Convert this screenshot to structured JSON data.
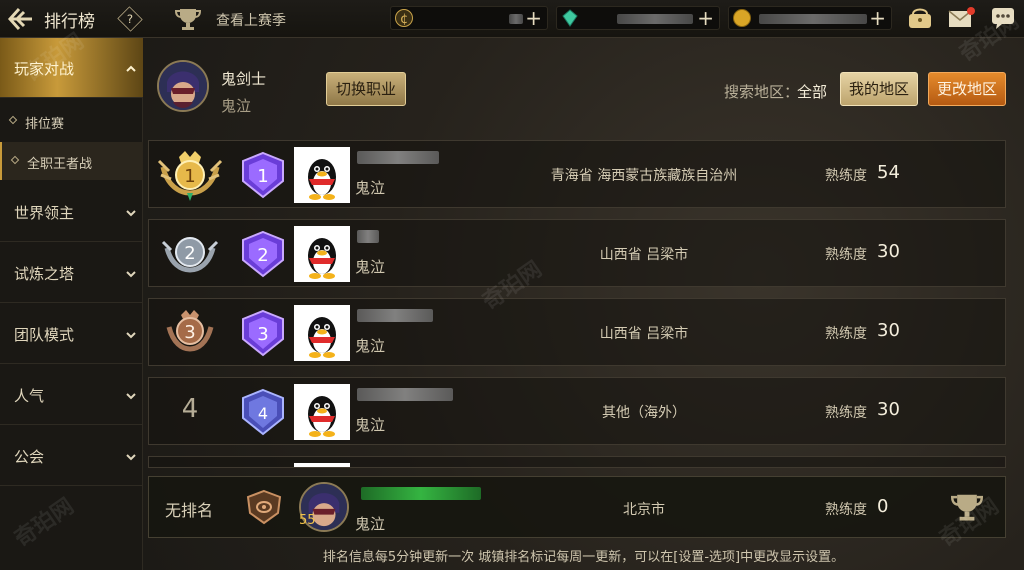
{
  "topbar": {
    "title": "排行榜",
    "help": "?",
    "last_season": "查看上赛季",
    "currencies": [
      {
        "icon": "coin-c-icon",
        "color": "#c9a34a"
      },
      {
        "icon": "gem-icon",
        "color": "#3fc9a0"
      },
      {
        "icon": "gold-coin-icon",
        "color": "#d9a526"
      }
    ],
    "plus": "+"
  },
  "sidebar": {
    "sections": [
      {
        "label": "玩家对战",
        "expanded": true
      },
      {
        "label": "世界领主"
      },
      {
        "label": "试炼之塔"
      },
      {
        "label": "团队模式"
      },
      {
        "label": "人气"
      },
      {
        "label": "公会"
      }
    ],
    "sub_items": [
      {
        "label": "排位赛"
      },
      {
        "label": "全职王者战",
        "active": true
      }
    ]
  },
  "header": {
    "class_name": "鬼剑士",
    "sub_class": "鬼泣",
    "switch_button": "切换职业",
    "region_label": "搜索地区：",
    "region_value": "全部",
    "my_region_button": "我的地区",
    "change_region_button": "更改地区"
  },
  "rows": [
    {
      "rank": "1",
      "badge": "1",
      "sub_name": "鬼泣",
      "location": "青海省 海西蒙古族藏族自治州",
      "prof_label": "熟练度",
      "prof_value": "54"
    },
    {
      "rank": "2",
      "badge": "2",
      "sub_name": "鬼泣",
      "location": "山西省 吕梁市",
      "prof_label": "熟练度",
      "prof_value": "30"
    },
    {
      "rank": "3",
      "badge": "3",
      "sub_name": "鬼泣",
      "location": "山西省 吕梁市",
      "prof_label": "熟练度",
      "prof_value": "30"
    },
    {
      "rank": "4",
      "badge": "4",
      "sub_name": "鬼泣",
      "location": "其他（海外）",
      "prof_label": "熟练度",
      "prof_value": "30"
    }
  ],
  "my_row": {
    "rank": "无排名",
    "level": "55",
    "sub_name": "鬼泣",
    "location": "北京市",
    "prof_label": "熟练度",
    "prof_value": "0"
  },
  "footer_note": "排名信息每5分钟更新一次 城镇排名标记每周一更新，可以在[设置-选项]中更改显示设置。",
  "watermark": "奇珀网",
  "colors": {
    "accent_gold": "#c89a3a",
    "orange_button": "#d9731f",
    "level_text": "#f1c24a"
  }
}
